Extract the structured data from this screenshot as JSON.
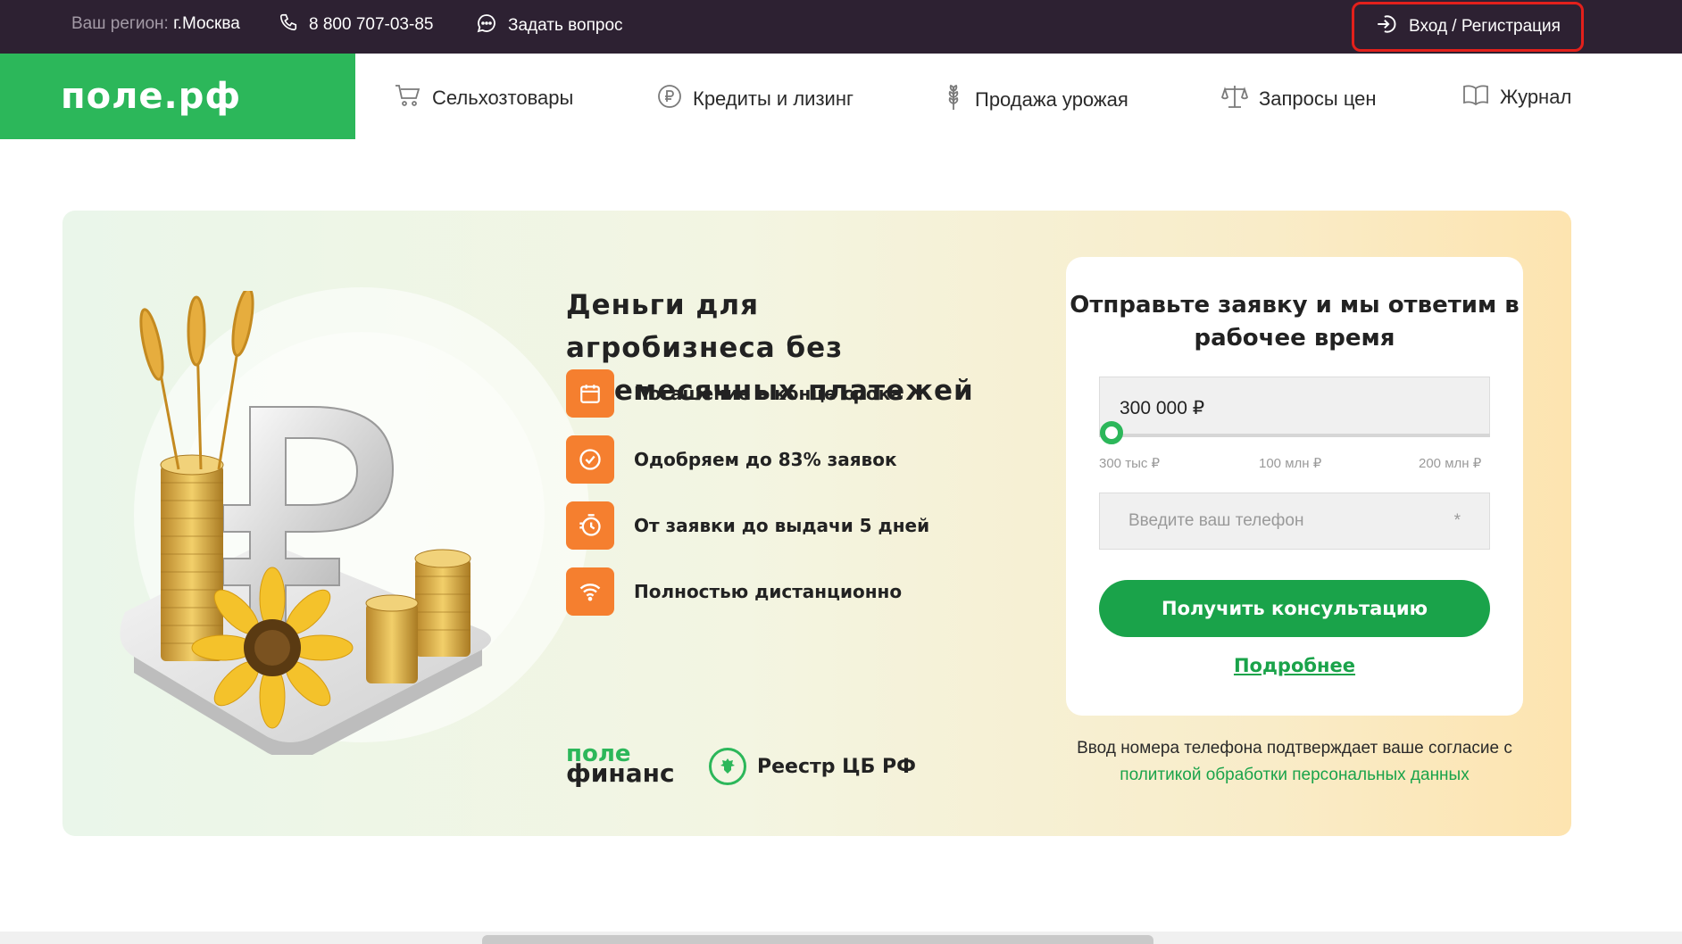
{
  "topbar": {
    "region_label": "Ваш регион:",
    "region_city": "г.Москва",
    "phone": "8 800 707-03-85",
    "ask_question": "Задать вопрос",
    "login": "Вход / Регистрация"
  },
  "logo": {
    "text": "поле.рф"
  },
  "nav": {
    "items": [
      {
        "label": "Сельхозтовары",
        "icon": "cart-icon"
      },
      {
        "label": "Кредиты и лизинг",
        "icon": "ruble-coin-icon"
      },
      {
        "label": "Продажа урожая",
        "icon": "wheat-icon"
      },
      {
        "label": "Запросы цен",
        "icon": "scales-icon"
      },
      {
        "label": "Журнал",
        "icon": "book-icon"
      }
    ]
  },
  "hero": {
    "title": "Деньги для агробизнеса без ежемесячных платежей",
    "features": [
      {
        "label": "Погашение в конце срока",
        "icon": "calendar-icon"
      },
      {
        "label": "Одобряем до 83% заявок",
        "icon": "check-circle-icon"
      },
      {
        "label": "От заявки до выдачи 5 дней",
        "icon": "timer-icon"
      },
      {
        "label": "Полностью дистанционно",
        "icon": "wifi-icon"
      }
    ],
    "brand_top": "поле",
    "brand_bottom": "финанс",
    "registry": "Реестр ЦБ РФ"
  },
  "form": {
    "title": "Отправьте заявку и мы ответим в рабочее время",
    "amount": "300 000 ₽",
    "slider_level": 0,
    "scale_min": "300 тыс ₽",
    "scale_mid": "100 млн ₽",
    "scale_max": "200 млн ₽",
    "phone_placeholder": "Введите ваш телефон",
    "required_mark": "*",
    "submit": "Получить консультацию",
    "more": "Подробнее"
  },
  "consent": {
    "text": "Ввод номера телефона подтверждает ваше согласие с",
    "link": "политикой обработки персональных данных"
  },
  "colors": {
    "topbar_bg": "#2d2132",
    "brand_green": "#2cb75a",
    "button_green": "#1aa34a",
    "feature_orange": "#f57f2f",
    "highlight_red": "#e3201b"
  }
}
